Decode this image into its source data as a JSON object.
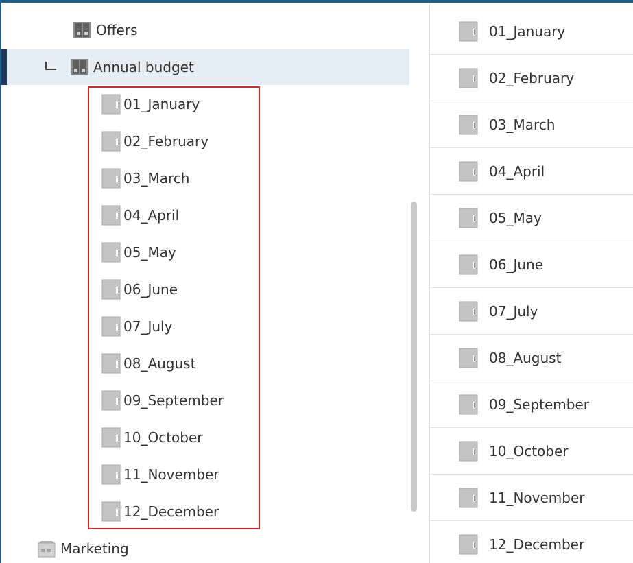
{
  "tree": {
    "items": [
      {
        "label": "Offers",
        "icon": "folder-icon"
      },
      {
        "label": "Annual budget",
        "icon": "folder-icon",
        "selected": true
      },
      {
        "label": "01_January",
        "icon": "document-icon"
      },
      {
        "label": "02_February",
        "icon": "document-icon"
      },
      {
        "label": "03_March",
        "icon": "document-icon"
      },
      {
        "label": "04_April",
        "icon": "document-icon"
      },
      {
        "label": "05_May",
        "icon": "document-icon"
      },
      {
        "label": "06_June",
        "icon": "document-icon"
      },
      {
        "label": "07_July",
        "icon": "document-icon"
      },
      {
        "label": "08_August",
        "icon": "document-icon"
      },
      {
        "label": "09_September",
        "icon": "document-icon"
      },
      {
        "label": "10_October",
        "icon": "document-icon"
      },
      {
        "label": "11_November",
        "icon": "document-icon"
      },
      {
        "label": "12_December",
        "icon": "document-icon"
      },
      {
        "label": "Marketing",
        "icon": "cabinet-icon"
      }
    ]
  },
  "list": {
    "items": [
      {
        "label": "01_January",
        "icon": "document-icon"
      },
      {
        "label": "02_February",
        "icon": "document-icon"
      },
      {
        "label": "03_March",
        "icon": "document-icon"
      },
      {
        "label": "04_April",
        "icon": "document-icon"
      },
      {
        "label": "05_May",
        "icon": "document-icon"
      },
      {
        "label": "06_June",
        "icon": "document-icon"
      },
      {
        "label": "07_July",
        "icon": "document-icon"
      },
      {
        "label": "08_August",
        "icon": "document-icon"
      },
      {
        "label": "09_September",
        "icon": "document-icon"
      },
      {
        "label": "10_October",
        "icon": "document-icon"
      },
      {
        "label": "11_November",
        "icon": "document-icon"
      },
      {
        "label": "12_December",
        "icon": "document-icon"
      }
    ]
  },
  "colors": {
    "accent": "#1f5f8b",
    "selection_bg": "#e6eef5",
    "selection_marker": "#1f3a5f",
    "highlight_box": "#e0232a"
  }
}
